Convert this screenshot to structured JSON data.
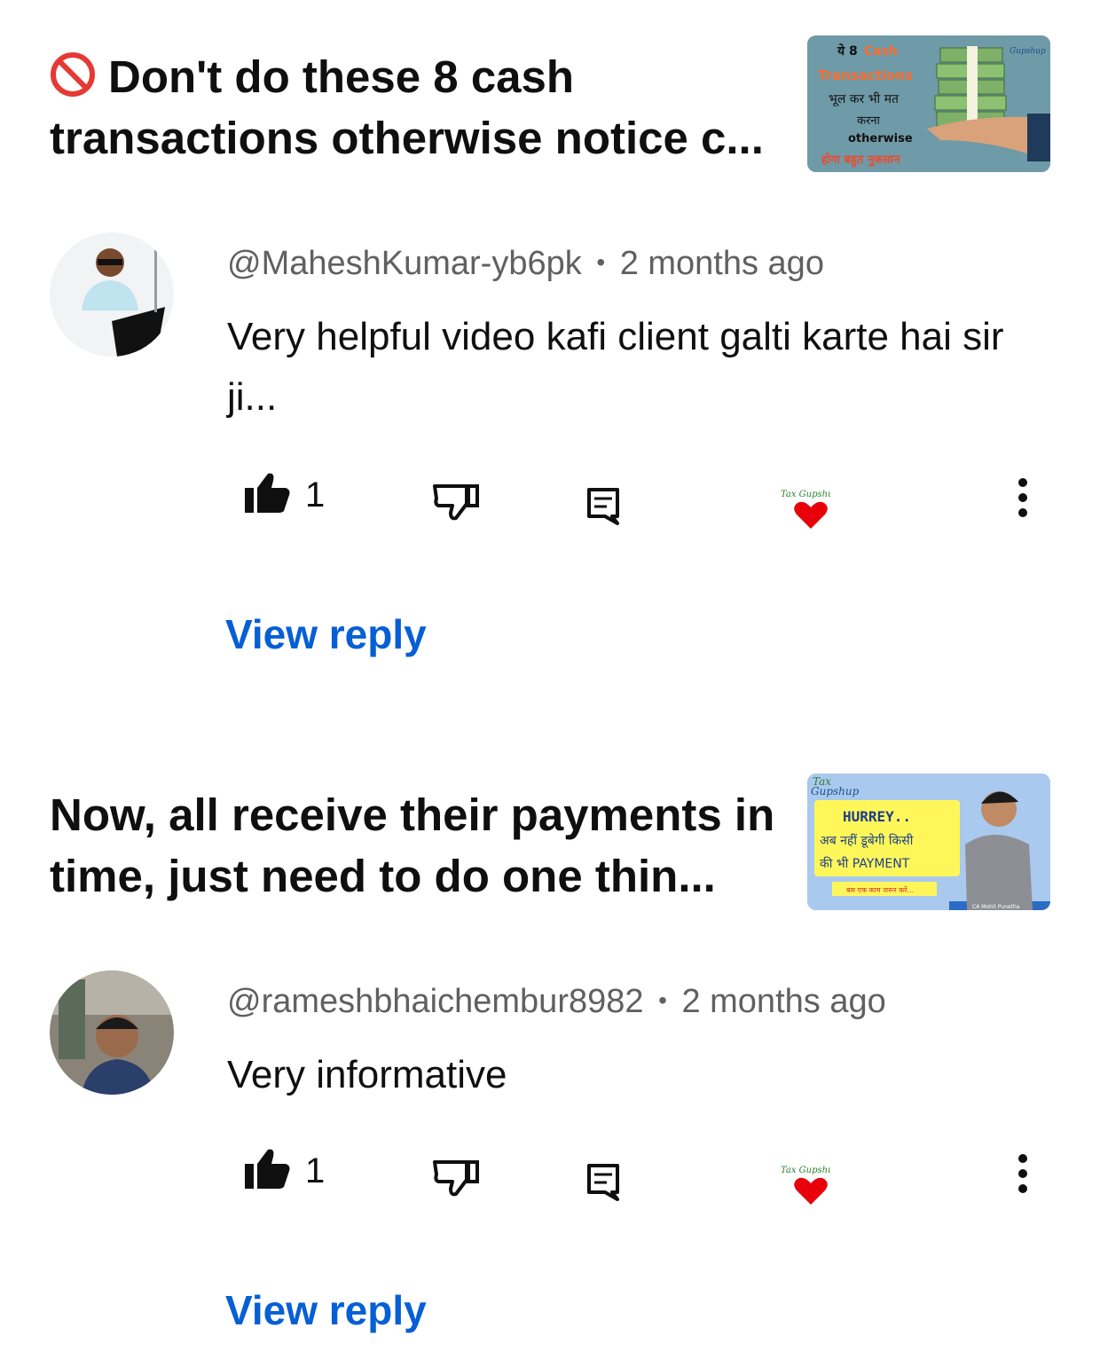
{
  "items": [
    {
      "video_title": "Don't do these 8 cash transactions otherwise notice c...",
      "thumbnail": {
        "lines": [
          "ये 8",
          "Cash",
          "Transactions",
          "भूल कर भी मत",
          "करना",
          "otherwise",
          "होगा बहुत नुकसान"
        ],
        "brand": "Gupshup"
      },
      "comment": {
        "author": "@MaheshKumar-yb6pk",
        "time": "2 months ago",
        "text": "Very helpful video kafi client galti karte hai sir ji...",
        "likes": "1",
        "creator_heart_label": "Tax Gupshup"
      },
      "view_reply": "View reply"
    },
    {
      "video_title": "Now, all receive their payments in time, just need to do one thin...",
      "thumbnail": {
        "brand_top": "Tax",
        "brand": "Gupshup",
        "lines": [
          "HURREY..",
          "अब नहीं डूबेगी किसी",
          "की भी PAYMENT"
        ],
        "caption": "बस एक काम जरूर करें...",
        "presenter": "CA Mohit Punetha"
      },
      "comment": {
        "author": "@rameshbhaichembur8982",
        "time": "2 months ago",
        "text": "Very informative",
        "likes": "1",
        "creator_heart_label": "Tax Gupshup"
      },
      "view_reply": "View reply"
    }
  ],
  "separator": "•",
  "icons": [
    "prohibited-icon",
    "thumbs-up-icon",
    "thumbs-down-icon",
    "reply-comment-icon",
    "creator-heart-icon",
    "more-vertical-icon"
  ],
  "colors": {
    "link": "#065fd4",
    "heart": "#e8000b",
    "ban": "#e53935",
    "meta": "#606060"
  }
}
